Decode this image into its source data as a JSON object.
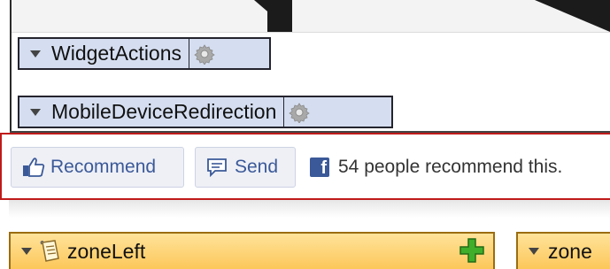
{
  "widgets": [
    {
      "label": "WidgetActions"
    },
    {
      "label": "MobileDeviceRedirection"
    }
  ],
  "facebook": {
    "recommend_label": "Recommend",
    "send_label": "Send",
    "logo_letter": "f",
    "count_text": "54 people recommend this.",
    "brand_color": "#3b5998",
    "highlight_color": "#c01a1a"
  },
  "zones": [
    {
      "label": "zoneLeft"
    },
    {
      "label": "zone"
    }
  ],
  "colors": {
    "widget_bg": "#d5def0",
    "zone_bg": "#fcc75a",
    "add_icon": "#3fae2a"
  },
  "icons": {
    "widget_toggle": "triangle-down-icon",
    "widget_settings": "gear-icon",
    "recommend": "thumbs-up-icon",
    "send": "send-icon",
    "zone_note": "note-icon",
    "zone_add": "plus-icon"
  }
}
